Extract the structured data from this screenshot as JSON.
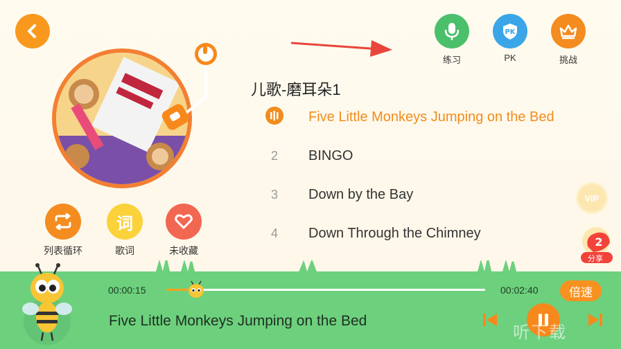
{
  "header": {
    "top_actions": [
      {
        "label": "练习",
        "icon": "microphone-icon",
        "color": "#4cbf6b"
      },
      {
        "label": "PK",
        "icon": "pk-shield-icon",
        "color": "#3aa6e8"
      },
      {
        "label": "挑战",
        "icon": "crown-icon",
        "color": "#f48c20"
      }
    ]
  },
  "album": {
    "title": "儿歌-磨耳朵1"
  },
  "actions": [
    {
      "label": "列表循环",
      "icon": "repeat-icon",
      "color": "#f48c20"
    },
    {
      "label": "歌词",
      "icon": "lyrics-icon",
      "glyph": "词",
      "color": "#fbd23a"
    },
    {
      "label": "未收藏",
      "icon": "heart-icon",
      "color": "#f26752"
    }
  ],
  "tracks": [
    {
      "num": "",
      "title": "Five Little Monkeys Jumping on the Bed",
      "active": true
    },
    {
      "num": "2",
      "title": "BINGO"
    },
    {
      "num": "3",
      "title": "Down by the Bay"
    },
    {
      "num": "4",
      "title": "Down Through the Chimney"
    }
  ],
  "badges": {
    "vip": "VIP",
    "share": "分享"
  },
  "player": {
    "current_time": "00:00:15",
    "total_time": "00:02:40",
    "progress": 0.094,
    "speed_label": "倍速",
    "now_playing": "Five Little Monkeys Jumping on the Bed",
    "watermark": "听下载"
  },
  "colors": {
    "accent": "#f7891c",
    "player_bg": "#6dd07d",
    "active_track": "#f28c1d"
  }
}
